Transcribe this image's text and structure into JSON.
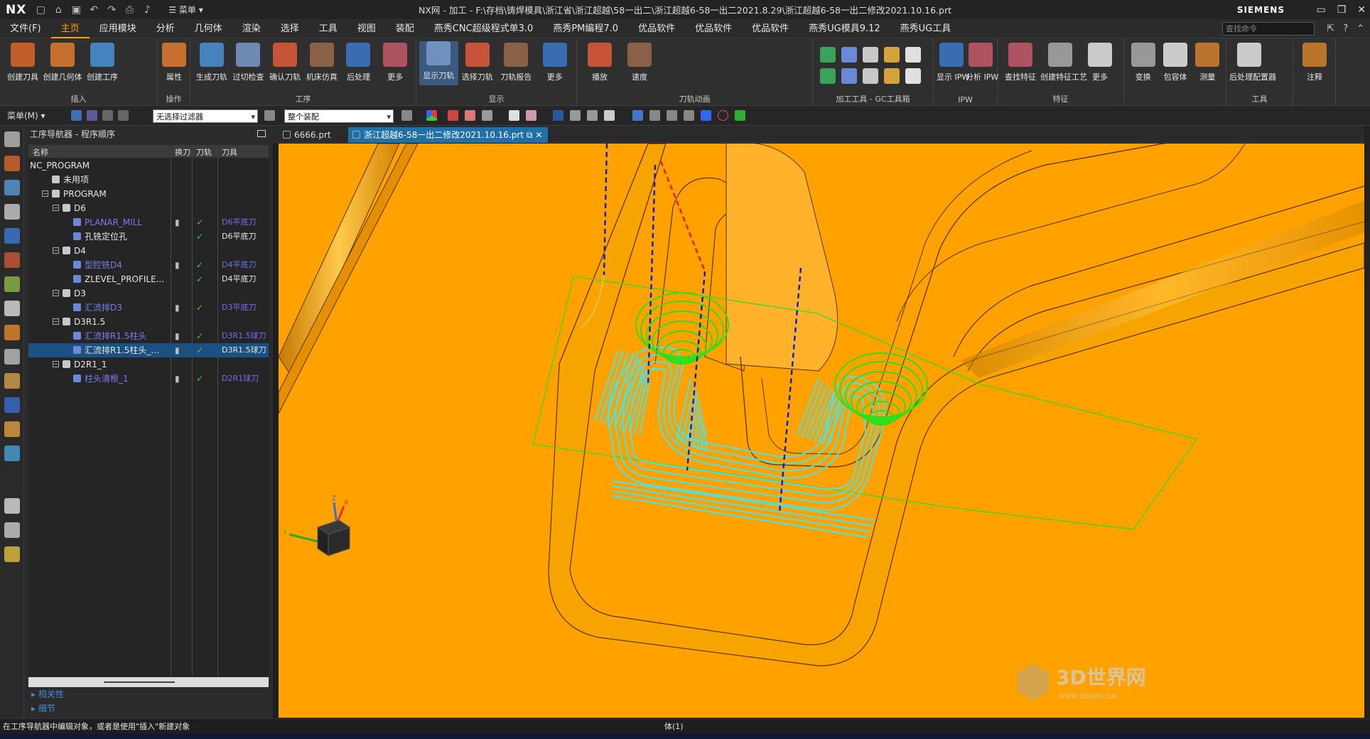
{
  "titlebar": {
    "logo": "NX",
    "menu_label": "菜单",
    "title": "NX网 - 加工 - F:\\存档\\铸焊模具\\浙江省\\浙江超越\\58一出二\\浙江超越6-58一出二2021.8.29\\浙江超越6-58一出二修改2021.10.16.prt",
    "brand": "SIEMENS"
  },
  "menu": {
    "items": [
      "文件(F)",
      "主页",
      "应用模块",
      "分析",
      "几何体",
      "渲染",
      "选择",
      "工具",
      "视图",
      "装配",
      "燕秀CNC超级程式单3.0",
      "燕秀PM编程7.0",
      "优品软件",
      "优品软件",
      "优品软件",
      "燕秀UG模具9.12",
      "燕秀UG工具"
    ],
    "active_index": 1,
    "search_placeholder": "查找命令"
  },
  "ribbon": {
    "groups": [
      {
        "label": "插入",
        "buttons": [
          "创建刀具",
          "创建几何体",
          "创建工序"
        ]
      },
      {
        "label": "操作",
        "buttons": [
          "属性"
        ]
      },
      {
        "label": "工序",
        "buttons": [
          "生成刀轨",
          "过切检查",
          "确认刀轨",
          "机床仿真",
          "后处理",
          "更多"
        ]
      },
      {
        "label": "显示",
        "buttons": [
          "显示刀轨",
          "选择刀轨",
          "刀轨报告",
          "更多"
        ]
      },
      {
        "label": "刀轨动画",
        "buttons": [
          "播放",
          "速度"
        ]
      },
      {
        "label": "加工工具 - GC工具箱",
        "buttons": []
      },
      {
        "label": "IPW",
        "buttons": [
          "显示 IPW",
          "分析 IPW"
        ]
      },
      {
        "label": "特征",
        "buttons": [
          "查找特征",
          "创建特征工艺",
          "更多"
        ]
      },
      {
        "label": "",
        "buttons": [
          "变换",
          "包容体",
          "测量"
        ]
      },
      {
        "label": "工具",
        "buttons": [
          "后处理配置器"
        ]
      },
      {
        "label": "",
        "buttons": [
          "注释"
        ]
      }
    ]
  },
  "toolbar2": {
    "menu": "菜单(M) ▾",
    "filter": "无选择过滤器",
    "assembly": "整个装配"
  },
  "navigator": {
    "title": "工序导航器 - 程序顺序",
    "columns": [
      "名称",
      "换刀",
      "刀轨",
      "刀具"
    ],
    "rows": [
      {
        "name": "NC_PROGRAM",
        "tool": "",
        "level": 0
      },
      {
        "name": "未用项",
        "tool": "",
        "level": 1
      },
      {
        "name": "PROGRAM",
        "tool": "",
        "level": 1
      },
      {
        "name": "D6",
        "tool": "",
        "level": 2
      },
      {
        "name": "PLANAR_MILL",
        "tool": "D6平底刀",
        "level": 3
      },
      {
        "name": "孔铣定位孔",
        "tool": "D6平底刀",
        "level": 3
      },
      {
        "name": "D4",
        "tool": "",
        "level": 2
      },
      {
        "name": "型腔铣D4",
        "tool": "D4平底刀",
        "level": 3
      },
      {
        "name": "ZLEVEL_PROFILE...",
        "tool": "D4平底刀",
        "level": 3
      },
      {
        "name": "D3",
        "tool": "",
        "level": 2
      },
      {
        "name": "汇流排D3",
        "tool": "D3平底刀",
        "level": 3
      },
      {
        "name": "D3R1.5",
        "tool": "",
        "level": 2
      },
      {
        "name": "汇流排R1.5柱头",
        "tool": "D3R1.5球刀",
        "level": 3
      },
      {
        "name": "汇流排R1.5柱头_...",
        "tool": "D3R1.5球刀",
        "level": 3
      },
      {
        "name": "D2R1_1",
        "tool": "",
        "level": 2
      },
      {
        "name": "柱头清根_1",
        "tool": "D2R1球刀",
        "level": 3
      }
    ],
    "sections": [
      "相关性",
      "细节"
    ]
  },
  "tabs": [
    "6666.prt",
    "浙江超越6-58一出二修改2021.10.16.prt"
  ],
  "status": {
    "left": "在工序导航器中编辑对象，或者是使用\"插入\"新建对象",
    "center": "体(1)"
  },
  "watermark": {
    "title": "3D世界网",
    "url": "WWW.3DSJW.COM"
  },
  "colors": {
    "viewport": "#ffa200",
    "toolpath_green": "#33dd22",
    "toolpath_cyan": "#40e6f0",
    "rapid_blue": "#1020d0",
    "rapid_red": "#e02020"
  }
}
